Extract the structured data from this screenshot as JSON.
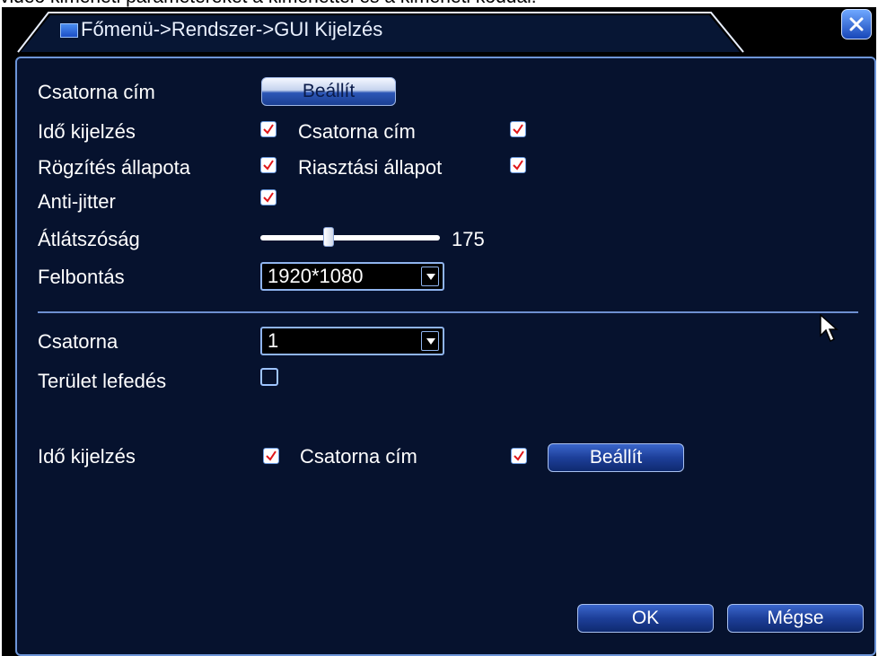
{
  "caption_text": "videó kimeneti paramétereket a kimenettel és a kimeneti kóddal.",
  "window": {
    "title": "Főmenü->Rendszer->GUI Kijelzés",
    "close_icon": "close-icon"
  },
  "settings": {
    "channel_title_label": "Csatorna cím",
    "channel_title_button": "Beállít",
    "time_display_label": "Idő kijelzés",
    "time_display_checked": true,
    "channel_title_check_label": "Csatorna cím",
    "channel_title_checked": true,
    "record_state_label": "Rögzítés állapota",
    "record_state_checked": true,
    "alarm_state_label": "Riasztási állapot",
    "alarm_state_checked": true,
    "anti_jitter_label": "Anti-jitter",
    "anti_jitter_checked": true,
    "transparency_label": "Átlátszóság",
    "transparency_value": "175",
    "resolution_label": "Felbontás",
    "resolution_value": "1920*1080"
  },
  "channel_section": {
    "channel_label": "Csatorna",
    "channel_value": "1",
    "area_cover_label": "Terület lefedés",
    "area_cover_checked": false,
    "time_display_label": "Idő kijelzés",
    "time_display_checked": true,
    "channel_title_label": "Csatorna cím",
    "channel_title_checked": true,
    "set_button": "Beállít"
  },
  "footer": {
    "ok_button": "OK",
    "cancel_button": "Mégse"
  }
}
